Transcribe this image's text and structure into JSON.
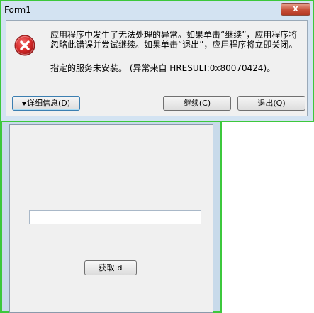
{
  "background_window": {
    "fetch_button_label": "获取id",
    "textbox_value": ""
  },
  "dialog": {
    "title": "Form1",
    "close_label": "x",
    "message": "应用程序中发生了无法处理的异常。如果单击“继续”，应用程序将忽略此错误并尝试继续。如果单击“退出”，应用程序将立即关闭。",
    "detail": "指定的服务未安装。 (异常来自 HRESULT:0x80070424)。",
    "buttons": {
      "details": "详细信息(D)",
      "continue": "继续(C)",
      "quit": "退出(Q)"
    }
  },
  "icons": {
    "error": "error-icon",
    "details_expand": "triangle-down-icon"
  },
  "colors": {
    "error_red": "#d82c2c",
    "window_border": "#3cc83c",
    "dialog_frame": "#d3e3f2",
    "client_bg": "#f0f0f0"
  }
}
